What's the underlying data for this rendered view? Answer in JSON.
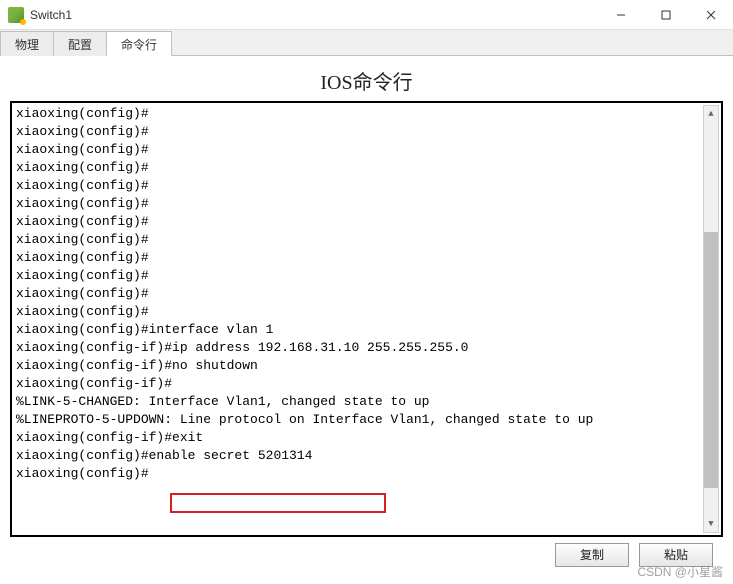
{
  "window": {
    "title": "Switch1"
  },
  "tabs": {
    "items": [
      {
        "label": "物理"
      },
      {
        "label": "配置"
      },
      {
        "label": "命令行"
      }
    ],
    "active": 2
  },
  "terminal": {
    "title": "IOS命令行",
    "lines": [
      "xiaoxing(config)#",
      "xiaoxing(config)#",
      "xiaoxing(config)#",
      "xiaoxing(config)#",
      "xiaoxing(config)#",
      "xiaoxing(config)#",
      "xiaoxing(config)#",
      "xiaoxing(config)#",
      "xiaoxing(config)#",
      "xiaoxing(config)#",
      "xiaoxing(config)#",
      "xiaoxing(config)#",
      "xiaoxing(config)#interface vlan 1",
      "xiaoxing(config-if)#ip address 192.168.31.10 255.255.255.0",
      "xiaoxing(config-if)#no shutdown",
      "",
      "xiaoxing(config-if)#",
      "%LINK-5-CHANGED: Interface Vlan1, changed state to up",
      "",
      "%LINEPROTO-5-UPDOWN: Line protocol on Interface Vlan1, changed state to up",
      "",
      "xiaoxing(config-if)#exit",
      "xiaoxing(config)#enable secret 5201314",
      "xiaoxing(config)#"
    ]
  },
  "buttons": {
    "copy": "复制",
    "paste": "粘贴"
  },
  "watermark": "CSDN @小星酱"
}
